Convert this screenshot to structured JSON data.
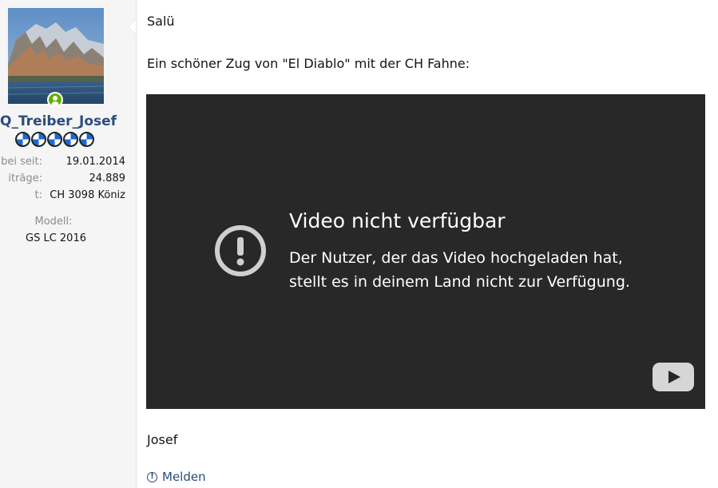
{
  "user": {
    "username": "Q_Treiber_Josef",
    "rank_icons": [
      "bmw-roundel-icon",
      "bmw-roundel-icon",
      "bmw-roundel-icon",
      "bmw-roundel-icon",
      "bmw-roundel-icon"
    ],
    "stats": [
      {
        "label": "abei seit:",
        "value": "19.01.2014"
      },
      {
        "label": "iträge:",
        "value": "24.889"
      },
      {
        "label": "t:",
        "value": "CH 3098 Köniz"
      }
    ],
    "model_label": "Modell:",
    "model_value": "GS LC 2016",
    "status": "online"
  },
  "message": {
    "greeting": "Salü",
    "intro": "Ein schöner Zug von \"El Diablo\" mit der CH Fahne:",
    "signoff": "Josef"
  },
  "video": {
    "title": "Video nicht verfügbar",
    "message": "Der Nutzer, der das Video hochgeladen hat, stellt es in deinem Land nicht zur Verfügung.",
    "icon": "warning-circle-icon",
    "logo": "youtube-logo-icon"
  },
  "actions": {
    "report_label": "Melden"
  },
  "colors": {
    "username": "#2b4c7e",
    "video_bg": "#282828",
    "online": "#63b000"
  }
}
